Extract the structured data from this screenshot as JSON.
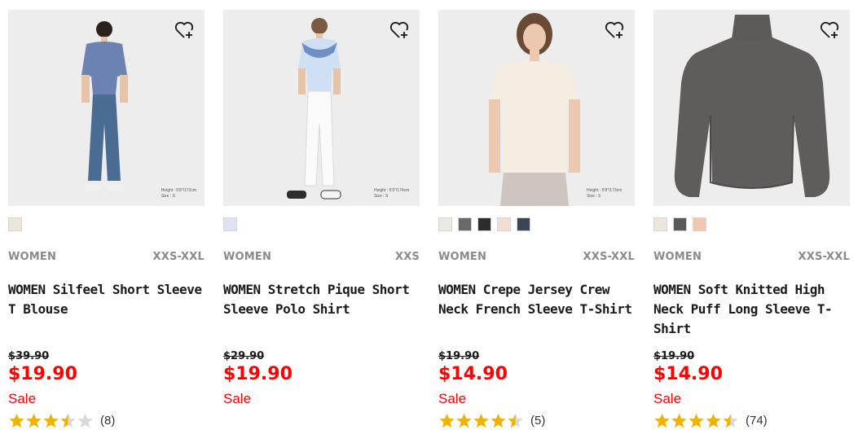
{
  "products": [
    {
      "category": "WOMEN",
      "sizes": "XXS-XXL",
      "name": "WOMEN Silfeel Short Sleeve T Blouse",
      "original_price": "$39.90",
      "price": "$19.90",
      "sale_label": "Sale",
      "rating": 3.5,
      "reviews": "(8)",
      "size_note_line1": "Height : 5'8\"/172cm",
      "size_note_line2": "Size : S",
      "swatches": [
        "#ebe5da"
      ],
      "favorite_icon": "heart-plus-icon"
    },
    {
      "category": "WOMEN",
      "sizes": "XXS",
      "name": "WOMEN Stretch Pique Short Sleeve Polo Shirt",
      "original_price": "$29.90",
      "price": "$19.90",
      "sale_label": "Sale",
      "rating": null,
      "reviews": "",
      "size_note_line1": "Height : 5'9\"/174cm",
      "size_note_line2": "Size : S",
      "swatches": [
        "#dde3f5"
      ],
      "favorite_icon": "heart-plus-icon"
    },
    {
      "category": "WOMEN",
      "sizes": "XXS-XXL",
      "name": "WOMEN Crepe Jersey Crew Neck French Sleeve T-Shirt",
      "original_price": "$19.90",
      "price": "$14.90",
      "sale_label": "Sale",
      "rating": 4.5,
      "reviews": "(5)",
      "size_note_line1": "Height : 5'8\"/173cm",
      "size_note_line2": "Size : S",
      "swatches": [
        "#ece8e2",
        "#6a6868",
        "#2c2c2c",
        "#f3ddd7",
        "#3b4556"
      ],
      "favorite_icon": "heart-plus-icon"
    },
    {
      "category": "WOMEN",
      "sizes": "XXS-XXL",
      "name": "WOMEN Soft Knitted High Neck Puff Long Sleeve T-Shirt",
      "original_price": "$19.90",
      "price": "$14.90",
      "sale_label": "Sale",
      "rating": 4.5,
      "reviews": "(74)",
      "size_note_line1": "",
      "size_note_line2": "",
      "swatches": [
        "#ece6dc",
        "#5a5858",
        "#f1c7b1"
      ],
      "favorite_icon": "heart-plus-icon"
    }
  ],
  "colors": {
    "price_red": "#ff0000",
    "star_gold": "#f0b400",
    "star_empty": "#d9d9d9"
  }
}
